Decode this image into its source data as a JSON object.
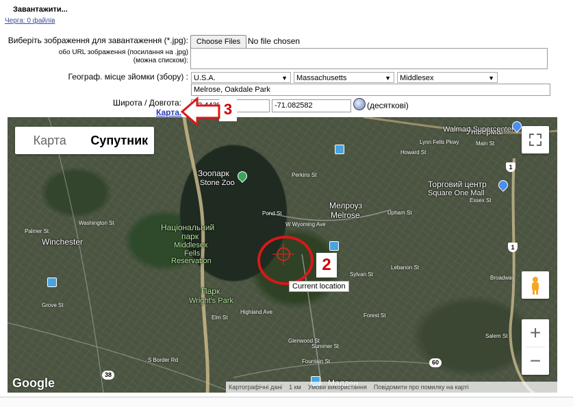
{
  "header": {
    "title": "Завантажити...",
    "queue": "Черга: 0 файлів"
  },
  "form": {
    "image_label": "Виберіть зображення для завантаження (*.jpg):",
    "choose_button": "Choose Files",
    "no_file": "No file chosen",
    "url_label_line1": "обо URL зображення (посилання на .jpg)",
    "url_label_line2": "(можна списком):",
    "url_value": "",
    "place_label": "Географ. місце зйомки (збору) :",
    "country": "U.S.A.",
    "state": "Massachusetts",
    "county": "Middlesex",
    "locality": "Melrose, Oakdale Park",
    "coords_label": "Широта / Довгота:",
    "latitude": "42.4438",
    "longitude": "-71.082582",
    "decimal_label": "(десяткові)",
    "map_link": "Карта."
  },
  "map": {
    "type_map": "Карта",
    "type_satellite": "Супутник",
    "active_type": "Супутник",
    "zoom_in": "+",
    "zoom_out": "−",
    "tooltip": "Current location",
    "logo": "Google",
    "footer": [
      "Картографічні дані",
      "1 км",
      "Умови використання",
      "Повідомити про помилку на карті"
    ],
    "places": {
      "univermag": "Універмаг",
      "walmart": "Walmart Supercenter",
      "zoo_uk": "Зоопарк",
      "zoo_en": "Stone Zoo",
      "melrose_uk": "Мелроуз",
      "melrose_en": "Melrose",
      "mall_uk": "Торговий центр",
      "mall_en": "Square One Mall",
      "winchester": "Winchester",
      "park_uk1": "Національний",
      "park_uk2": "парк",
      "park_en1": "Middlesex",
      "park_en2": "Fells",
      "park_en3": "Reservation",
      "wright_uk": "Парк",
      "wright_en": "Wright's Park",
      "malden": "Малден"
    },
    "roads": [
      "Lynn Fells Pkwy",
      "Howard St",
      "Main St",
      "Perkins St",
      "Pond St",
      "W Wyoming Ave",
      "Upham St",
      "Sylvan St",
      "Elm St",
      "Highland Ave",
      "Glenwood St",
      "Fountain St",
      "Summer St",
      "Forest St",
      "Salem St",
      "Broadway",
      "S Border Rd",
      "Washington St",
      "Palmer St",
      "Grove St",
      "Essex St",
      "Lebanon St"
    ],
    "route_1": "1",
    "route_60": "60",
    "route_38": "38"
  },
  "annotations": {
    "marker_2": "2",
    "marker_3": "3"
  },
  "colors": {
    "annotation": "#cc0000",
    "link": "#2a3ab0"
  }
}
